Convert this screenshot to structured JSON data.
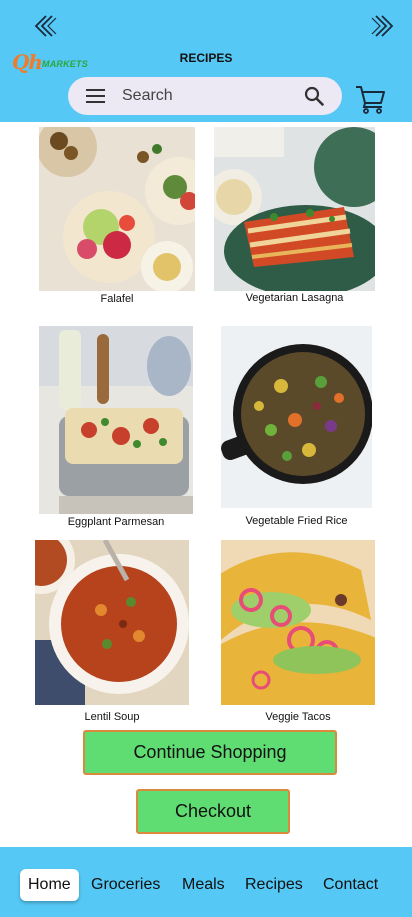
{
  "header": {
    "title": "RECIPES",
    "logo_big": "Qh",
    "logo_small": "MARKETS",
    "back_icon": "double-chevron-left",
    "forward_icon": "double-chevron-right"
  },
  "search": {
    "placeholder": "Search",
    "value": ""
  },
  "recipes": [
    {
      "name": "Falafel"
    },
    {
      "name": "Vegetarian Lasagna"
    },
    {
      "name": "Eggplant Parmesan"
    },
    {
      "name": "Vegetable Fried Rice"
    },
    {
      "name": "Lentil Soup"
    },
    {
      "name": "Veggie Tacos"
    }
  ],
  "actions": {
    "continue_label": "Continue Shopping",
    "checkout_label": "Checkout"
  },
  "bottom_nav": {
    "items": [
      "Home",
      "Groceries",
      "Meals",
      "Recipes",
      "Contact"
    ],
    "active": "Home"
  },
  "colors": {
    "header_bg": "#55c8f5",
    "button_bg": "#5fdc72",
    "button_border": "#d98a3c",
    "logo_orange": "#f07b2a",
    "logo_green": "#2aa83a"
  }
}
